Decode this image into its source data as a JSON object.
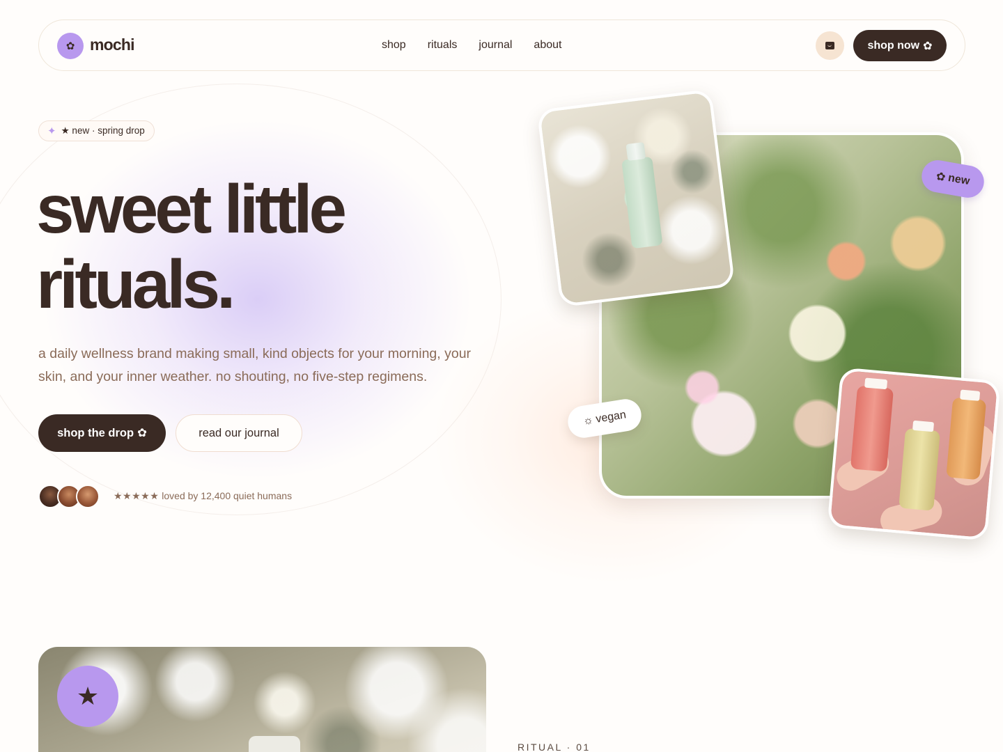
{
  "brand": {
    "name": "mochi",
    "logo_icon": "flower-icon",
    "accent": "#b898ee",
    "ink": "#3a2a24",
    "muted": "#8a6b58"
  },
  "nav": {
    "links": [
      "shop",
      "rituals",
      "journal",
      "about"
    ],
    "cart_icon": "shopping-bag-icon",
    "cta_label": "shop now",
    "cta_icon": "flower-icon"
  },
  "hero": {
    "pill_icon": "sparkle-icon",
    "pill_text": "★ new · spring drop",
    "headline_line1": "sweet little",
    "headline_line2": "rituals.",
    "subtitle": "a daily wellness brand making small, kind objects for your morning, your skin, and your inner weather. no shouting, no five-step regimens.",
    "primary_cta": "shop the drop",
    "primary_cta_icon": "flower-icon",
    "secondary_cta": "read our journal",
    "rating_stars": "★★★★★",
    "social_proof": "loved by 12,400 quiet humans"
  },
  "collage": {
    "tag_new": "new",
    "tag_new_icon": "flower-icon",
    "tag_vegan": "vegan",
    "tag_vegan_icon": "sun-icon"
  },
  "section": {
    "badge_icon": "star-icon",
    "ritual_label": "RITUAL · 01"
  }
}
